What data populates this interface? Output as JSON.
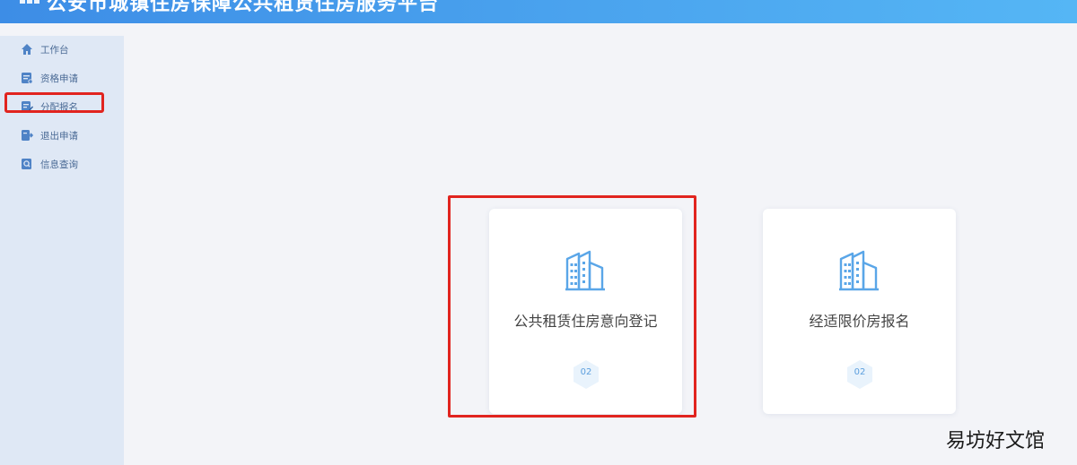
{
  "header": {
    "title": "公安市城镇住房保障公共租赁住房服务平台",
    "gradient_start": "#3d8de6",
    "gradient_end": "#55b6f5"
  },
  "sidebar": {
    "items": [
      {
        "label": "工作台",
        "icon": "home-icon"
      },
      {
        "label": "资格申请",
        "icon": "application-form-icon"
      },
      {
        "label": "分配报名",
        "icon": "edit-document-icon",
        "highlighted": true
      },
      {
        "label": "退出申请",
        "icon": "exit-document-icon"
      },
      {
        "label": "信息查询",
        "icon": "search-document-icon"
      }
    ]
  },
  "cards": [
    {
      "label": "公共租赁住房意向登记",
      "icon": "building-icon",
      "badge": "02",
      "highlighted": true
    },
    {
      "label": "经适限价房报名",
      "icon": "building-icon",
      "badge": "02"
    }
  ],
  "watermark": "易坊好文馆",
  "colors": {
    "highlight_border": "#e1241f",
    "sidebar_bg": "#dfe8f5",
    "sidebar_text": "#4a6a95",
    "icon_blue": "#5aa6e8",
    "page_bg": "#f3f4f8"
  }
}
